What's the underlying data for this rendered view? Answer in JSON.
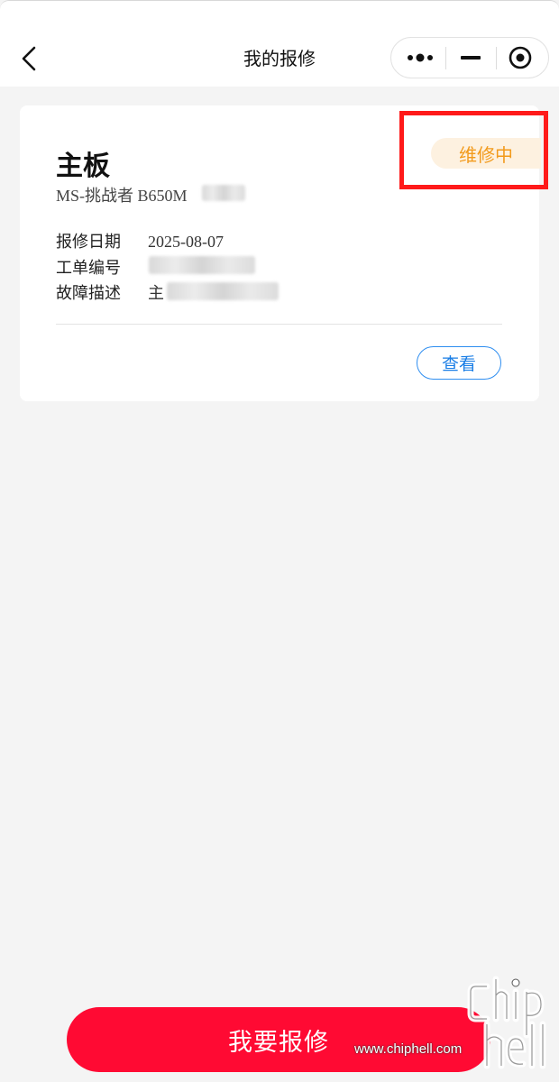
{
  "nav": {
    "title": "我的报修",
    "icons": {
      "back": "chevron-left-icon",
      "more": "more-dots-icon",
      "minimize": "minimize-icon",
      "close": "target-circle-icon"
    }
  },
  "card": {
    "title": "主板",
    "model": "MS-挑战者 B650M",
    "status": "维修中",
    "date_label": "报修日期",
    "date_value": "2025-08-07",
    "order_label": "工单编号",
    "desc_label": "故障描述",
    "desc_value_prefix": "主",
    "view_label": "查看"
  },
  "footer": {
    "report_label": "我要报修"
  },
  "watermark": {
    "text": "www.chiphell.com"
  },
  "colors": {
    "accent_red": "#ff0a33",
    "status_orange": "#f29a1b",
    "link_blue": "#1a7ee6",
    "highlight": "#ff1a1a"
  }
}
